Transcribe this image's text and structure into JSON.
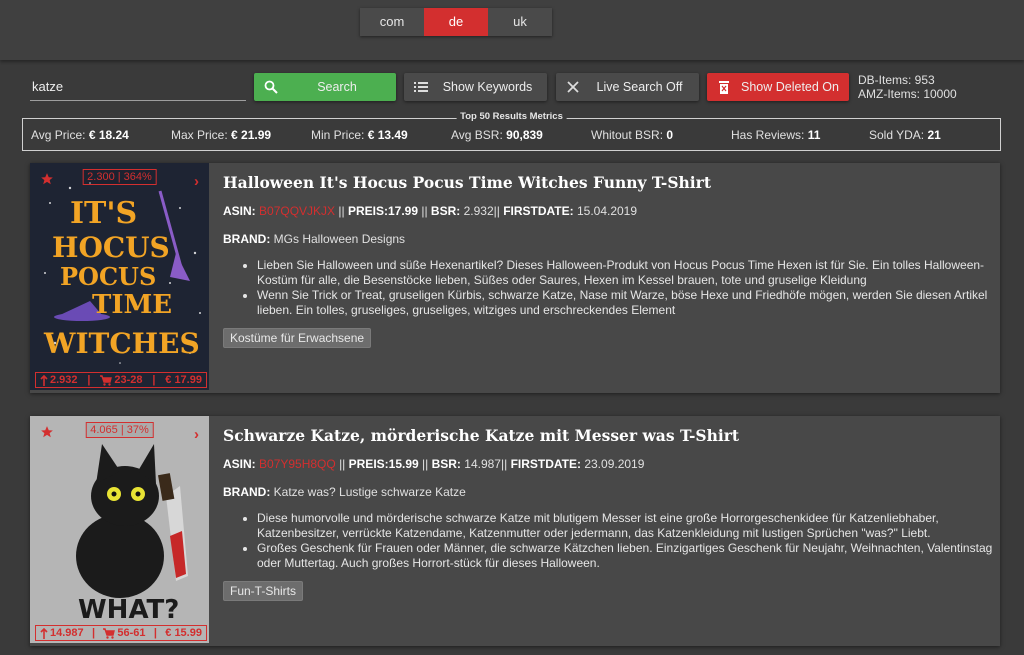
{
  "marketplaces": {
    "com": "com",
    "de": "de",
    "uk": "uk",
    "active": "de"
  },
  "search": {
    "value": "katze",
    "placeholder": ""
  },
  "buttons": {
    "search": "Search",
    "keywords": "Show Keywords",
    "live": "Live Search Off",
    "deleted": "Show Deleted On"
  },
  "db": {
    "db_items": "DB-Items: 953",
    "amz_items": "AMZ-Items: 10000"
  },
  "metrics": {
    "title": "Top 50 Results Metrics",
    "avg_price_label": "Avg Price:",
    "avg_price": "€ 18.24",
    "max_price_label": "Max Price:",
    "max_price": "€ 21.99",
    "min_price_label": "Min Price:",
    "min_price": "€ 13.49",
    "avg_bsr_label": "Avg BSR:",
    "avg_bsr": "90,839",
    "without_bsr_label": "Whitout BSR:",
    "without_bsr": "0",
    "reviews_label": "Has Reviews:",
    "reviews": "11",
    "sold_label": "Sold YDA:",
    "sold": "21"
  },
  "colors": {
    "accent_red": "#d32f2f",
    "green": "#4caf50",
    "bg": "#3a3a3a",
    "card": "#484848"
  },
  "products": [
    {
      "title": "Halloween It's Hocus Pocus Time Witches Funny T-Shirt",
      "asin_label": "ASIN:",
      "asin": "B07QQVJKJX",
      "sep1": " || ",
      "price_label": "PREIS:",
      "price": "17.99",
      "sep2": " || ",
      "bsr_label": "BSR:",
      "bsr": " 2.932",
      "sep3": "|| ",
      "date_label": "FIRSTDATE:",
      "date": " 15.04.2019",
      "brand_label": "BRAND:",
      "brand": " MGs Halloween Designs",
      "bullets": [
        "Lieben Sie Halloween und süße Hexenartikel? Dieses Halloween-Produkt von Hocus Pocus Time Hexen ist für Sie. Ein tolles Halloween-Kostüm für alle, die Besenstöcke lieben, Süßes oder Saures, Hexen im Kessel brauen, tote und gruselige Kleidung",
        "Wenn Sie Trick or Treat, gruseligen Kürbis, schwarze Katze, Nase mit Warze, böse Hexe und Friedhöfe mögen, werden Sie diesen Artikel lieben. Ein tolles, gruseliges, gruseliges, witziges und erschreckendes Element"
      ],
      "tag": "Kostüme für Erwachsene",
      "badge_top": "2.300 | 364%",
      "badge_bsr": "2.932",
      "badge_sep1": "|",
      "badge_cart": "23-28",
      "badge_sep2": "|",
      "badge_price": "€ 17.99",
      "art_lines": [
        "IT'S",
        "HOCUS",
        "POCUS",
        "TIME",
        "WITCHES"
      ]
    },
    {
      "title": "Schwarze Katze, mörderische Katze mit Messer was T-Shirt",
      "asin_label": "ASIN:",
      "asin": "B07Y95H8QQ",
      "sep1": " || ",
      "price_label": "PREIS:",
      "price": "15.99",
      "sep2": " || ",
      "bsr_label": "BSR:",
      "bsr": " 14.987",
      "sep3": "|| ",
      "date_label": "FIRSTDATE:",
      "date": " 23.09.2019",
      "brand_label": "BRAND:",
      "brand": " Katze was? Lustige schwarze Katze",
      "bullets": [
        "Diese humorvolle und mörderische schwarze Katze mit blutigem Messer ist eine große Horrorgeschenkidee für Katzenliebhaber, Katzenbesitzer, verrückte Katzendame, Katzenmutter oder jedermann, das Katzenkleidung mit lustigen Sprüchen \"was?\" Liebt.",
        "Großes Geschenk für Frauen oder Männer, die schwarze Kätzchen lieben. Einzigartiges Geschenk für Neujahr, Weihnachten, Valentinstag oder Muttertag. Auch großes Horrort-stück für dieses Halloween."
      ],
      "tag": "Fun-T-Shirts",
      "badge_top": "4.065 | 37%",
      "badge_bsr": "14.987",
      "badge_sep1": "|",
      "badge_cart": "56-61",
      "badge_sep2": "|",
      "badge_price": "€ 15.99",
      "art_lines": [
        "WHAT?"
      ]
    }
  ]
}
